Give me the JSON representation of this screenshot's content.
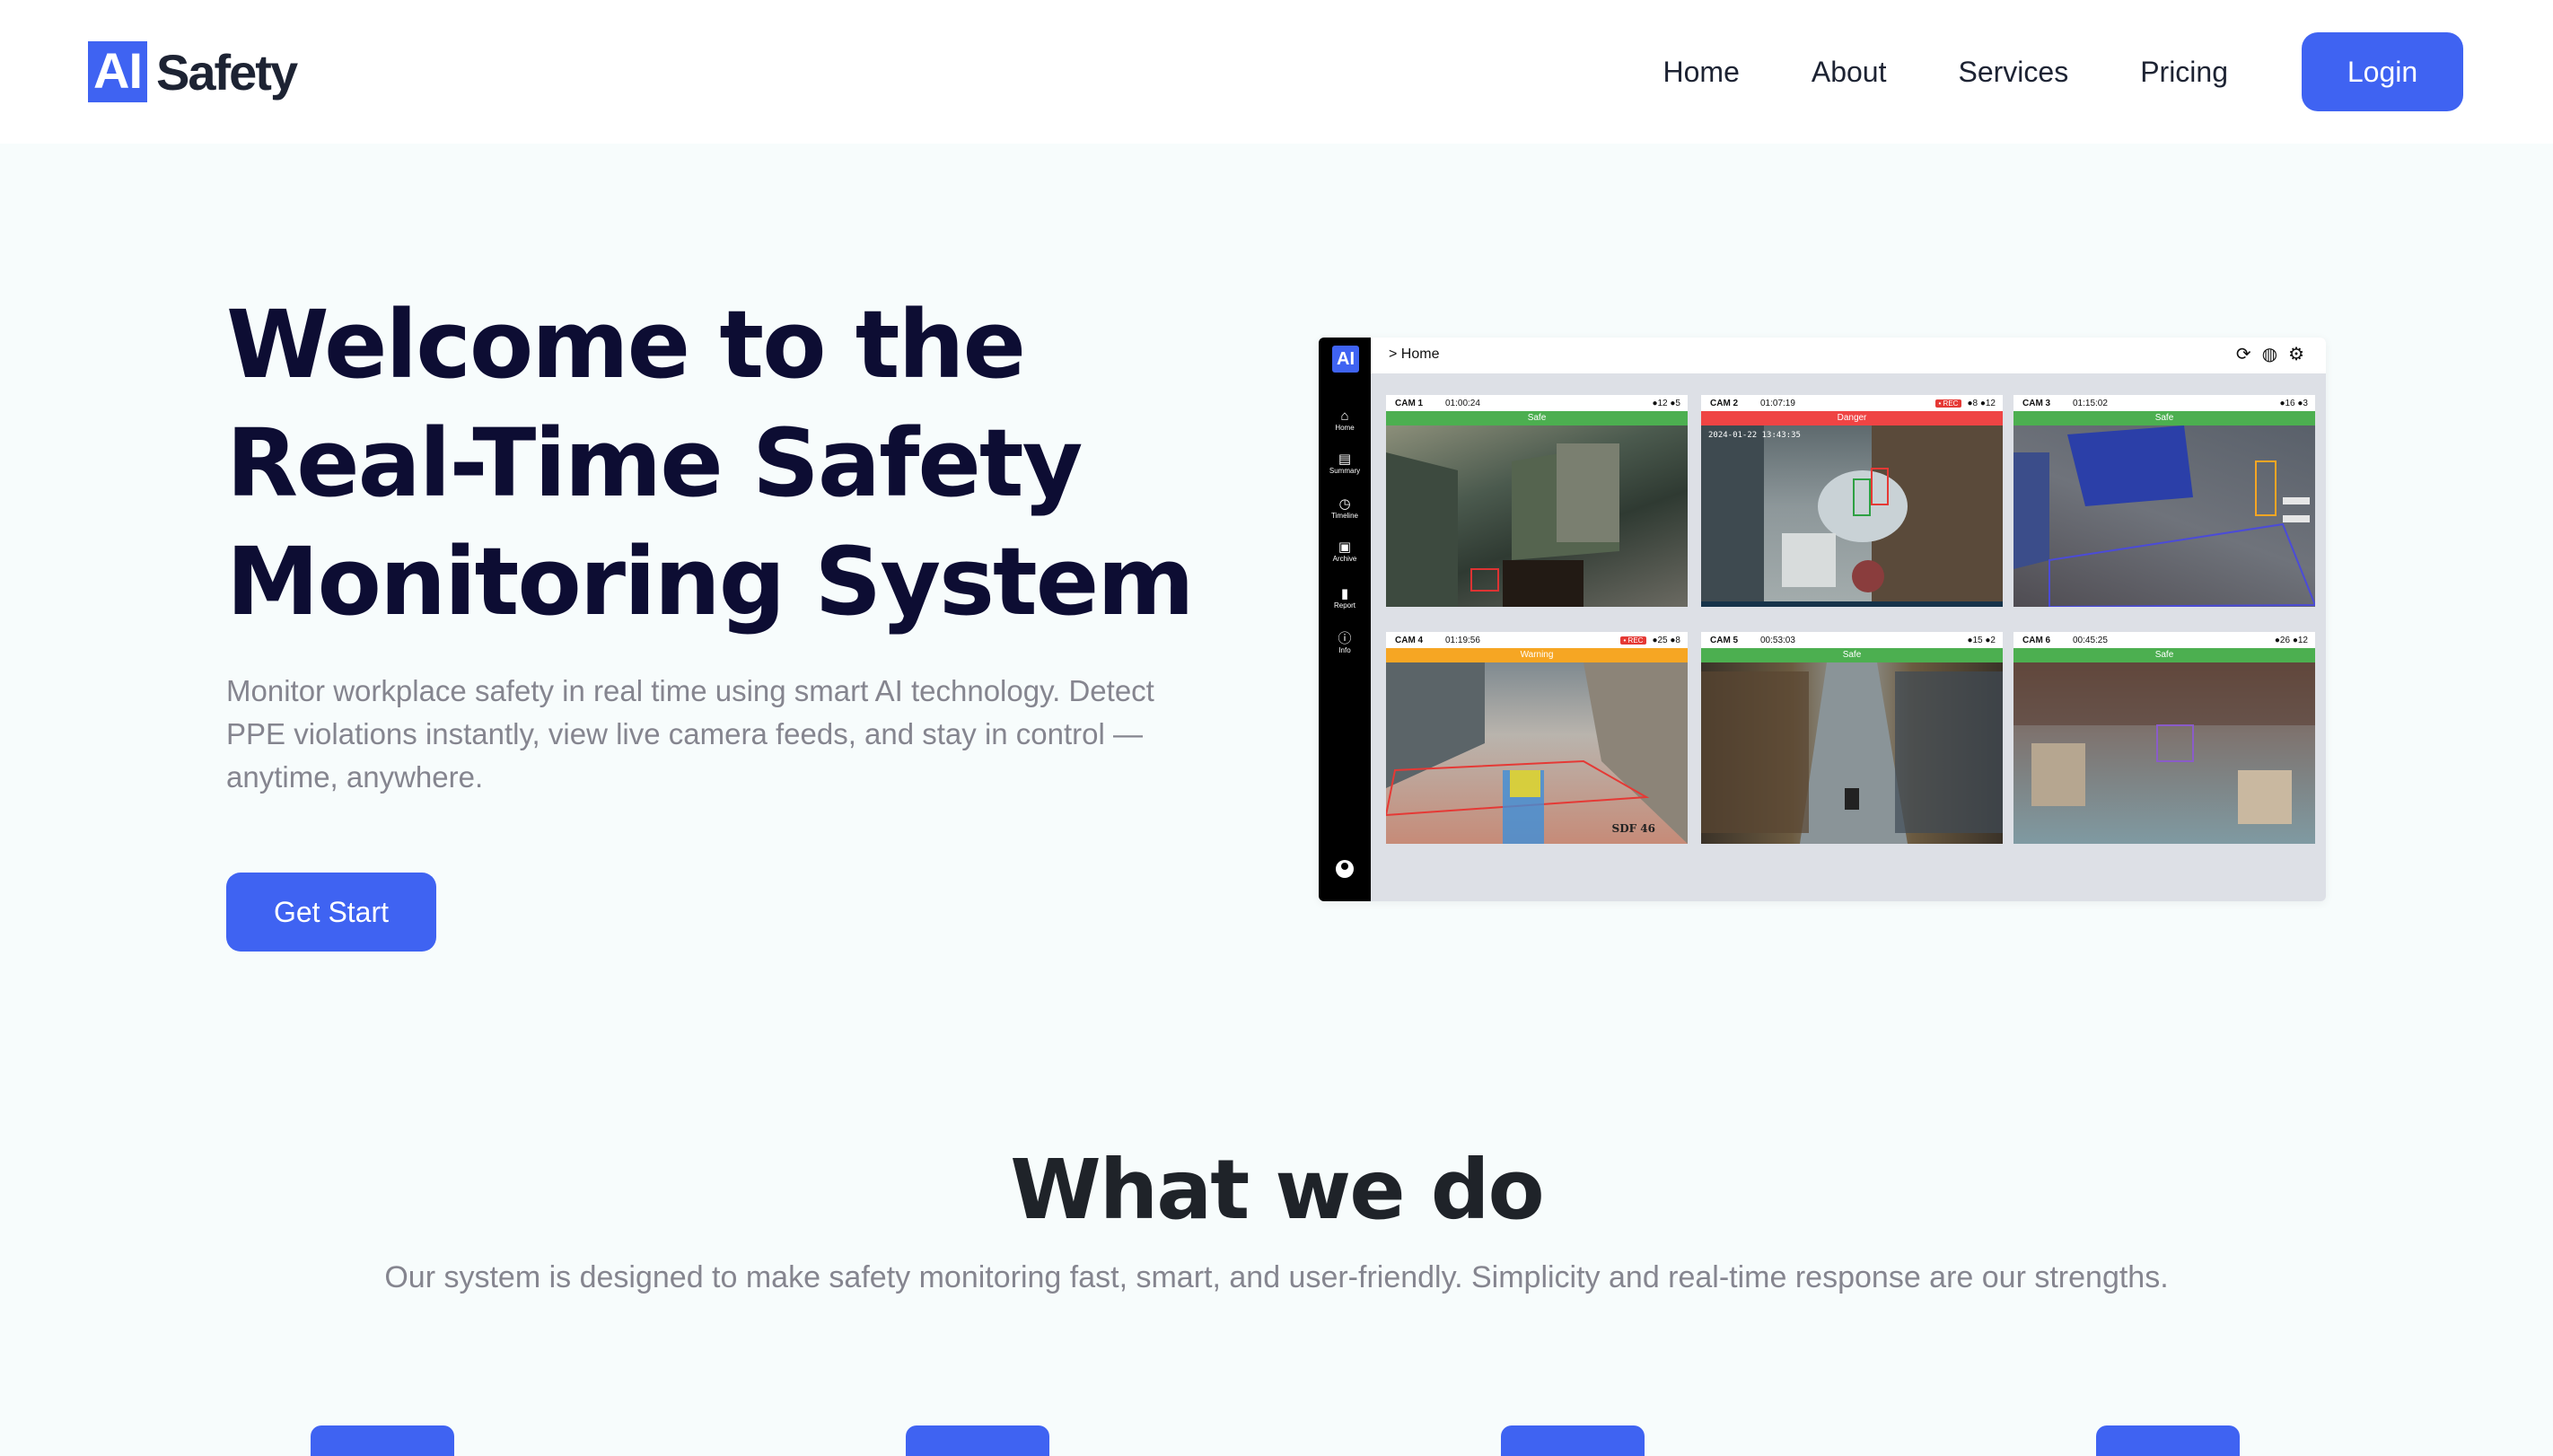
{
  "header": {
    "logo_mark": "AI",
    "logo_text": "Safety",
    "nav": [
      "Home",
      "About",
      "Services",
      "Pricing"
    ],
    "login_label": "Login"
  },
  "hero": {
    "title_lines": [
      "Welcome to the",
      "Real-Time Safety",
      "Monitoring System"
    ],
    "description": "Monitor workplace safety in real time using smart AI technology. Detect PPE violations instantly, view live camera feeds, and stay in control — anytime, anywhere.",
    "cta_label": "Get Start"
  },
  "dashboard": {
    "logo": "AI",
    "breadcrumb": "> Home",
    "sidebar": [
      {
        "label": "Home",
        "icon": "home-icon"
      },
      {
        "label": "Summary",
        "icon": "summary-icon"
      },
      {
        "label": "Timeline",
        "icon": "timeline-icon"
      },
      {
        "label": "Archive",
        "icon": "archive-icon"
      },
      {
        "label": "Report",
        "icon": "report-icon"
      },
      {
        "label": "Info",
        "icon": "info-icon"
      }
    ],
    "tools": [
      "refresh-icon",
      "globe-icon",
      "gear-icon"
    ],
    "status_colors": {
      "Safe": "#4caf50",
      "Danger": "#ef4444",
      "Warning": "#f6a623"
    },
    "cameras": [
      {
        "name": "CAM 1",
        "time": "01:00:24",
        "rec": "",
        "stats": "●12 ●5",
        "status": "Safe",
        "stamp": "",
        "label": ""
      },
      {
        "name": "CAM 2",
        "time": "01:07:19",
        "rec": "• REC",
        "stats": "●8 ●12",
        "status": "Danger",
        "stamp": "2024-01-22 13:43:35",
        "label": ""
      },
      {
        "name": "CAM 3",
        "time": "01:15:02",
        "rec": "",
        "stats": "●16 ●3",
        "status": "Safe",
        "stamp": "",
        "label": ""
      },
      {
        "name": "CAM 4",
        "time": "01:19:56",
        "rec": "• REC",
        "stats": "●25 ●8",
        "status": "Warning",
        "stamp": "",
        "label": "SDF 46"
      },
      {
        "name": "CAM 5",
        "time": "00:53:03",
        "rec": "",
        "stats": "●15 ●2",
        "status": "Safe",
        "stamp": "",
        "label": ""
      },
      {
        "name": "CAM 6",
        "time": "00:45:25",
        "rec": "",
        "stats": "●26 ●12",
        "status": "Safe",
        "stamp": "",
        "label": ""
      }
    ]
  },
  "features": {
    "title": "What we do",
    "description": "Our system is designed to make safety monitoring fast, smart, and user-friendly. Simplicity and real-time response are our strengths."
  }
}
